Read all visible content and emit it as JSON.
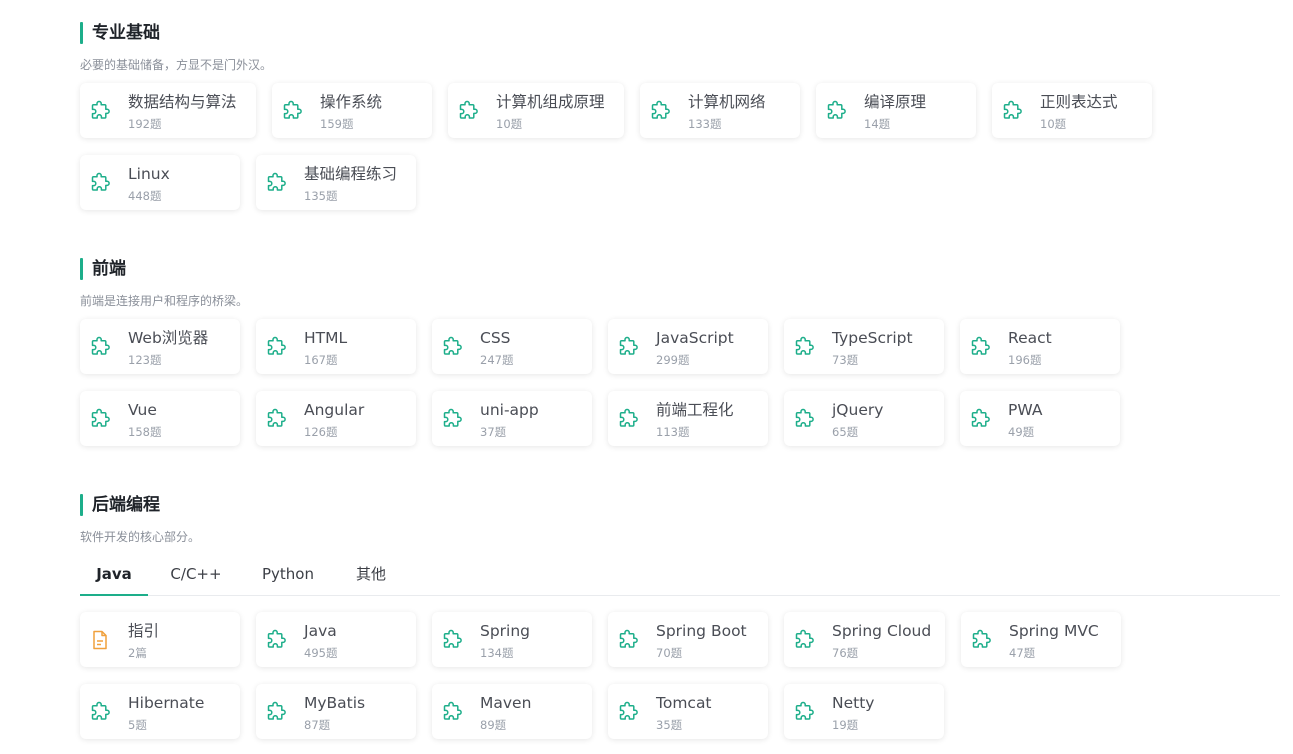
{
  "colors": {
    "accent": "#1dae8a",
    "doc_icon": "#f0a03c"
  },
  "sections": [
    {
      "title": "专业基础",
      "desc": "必要的基础储备，方显不是门外汉。",
      "items": [
        {
          "name": "数据结构与算法",
          "count": "192题",
          "icon": "puzzle-icon"
        },
        {
          "name": "操作系统",
          "count": "159题",
          "icon": "puzzle-icon"
        },
        {
          "name": "计算机组成原理",
          "count": "10题",
          "icon": "puzzle-icon"
        },
        {
          "name": "计算机网络",
          "count": "133题",
          "icon": "puzzle-icon"
        },
        {
          "name": "编译原理",
          "count": "14题",
          "icon": "puzzle-icon"
        },
        {
          "name": "正则表达式",
          "count": "10题",
          "icon": "puzzle-icon"
        },
        {
          "name": "Linux",
          "count": "448题",
          "icon": "puzzle-icon"
        },
        {
          "name": "基础编程练习",
          "count": "135题",
          "icon": "puzzle-icon"
        }
      ]
    },
    {
      "title": "前端",
      "desc": "前端是连接用户和程序的桥梁。",
      "items": [
        {
          "name": "Web浏览器",
          "count": "123题",
          "icon": "puzzle-icon"
        },
        {
          "name": "HTML",
          "count": "167题",
          "icon": "puzzle-icon"
        },
        {
          "name": "CSS",
          "count": "247题",
          "icon": "puzzle-icon"
        },
        {
          "name": "JavaScript",
          "count": "299题",
          "icon": "puzzle-icon"
        },
        {
          "name": "TypeScript",
          "count": "73题",
          "icon": "puzzle-icon"
        },
        {
          "name": "React",
          "count": "196题",
          "icon": "puzzle-icon"
        },
        {
          "name": "Vue",
          "count": "158题",
          "icon": "puzzle-icon"
        },
        {
          "name": "Angular",
          "count": "126题",
          "icon": "puzzle-icon"
        },
        {
          "name": "uni-app",
          "count": "37题",
          "icon": "puzzle-icon"
        },
        {
          "name": "前端工程化",
          "count": "113题",
          "icon": "puzzle-icon"
        },
        {
          "name": "jQuery",
          "count": "65题",
          "icon": "puzzle-icon"
        },
        {
          "name": "PWA",
          "count": "49题",
          "icon": "puzzle-icon"
        }
      ]
    },
    {
      "title": "后端编程",
      "desc": "软件开发的核心部分。",
      "tabs": [
        "Java",
        "C/C++",
        "Python",
        "其他"
      ],
      "active_tab": "Java",
      "items": [
        {
          "name": "指引",
          "count": "2篇",
          "icon": "document-icon"
        },
        {
          "name": "Java",
          "count": "495题",
          "icon": "puzzle-icon"
        },
        {
          "name": "Spring",
          "count": "134题",
          "icon": "puzzle-icon"
        },
        {
          "name": "Spring Boot",
          "count": "70题",
          "icon": "puzzle-icon"
        },
        {
          "name": "Spring Cloud",
          "count": "76题",
          "icon": "puzzle-icon"
        },
        {
          "name": "Spring MVC",
          "count": "47题",
          "icon": "puzzle-icon"
        },
        {
          "name": "Hibernate",
          "count": "5题",
          "icon": "puzzle-icon"
        },
        {
          "name": "MyBatis",
          "count": "87题",
          "icon": "puzzle-icon"
        },
        {
          "name": "Maven",
          "count": "89题",
          "icon": "puzzle-icon"
        },
        {
          "name": "Tomcat",
          "count": "35题",
          "icon": "puzzle-icon"
        },
        {
          "name": "Netty",
          "count": "19题",
          "icon": "puzzle-icon"
        }
      ]
    }
  ]
}
